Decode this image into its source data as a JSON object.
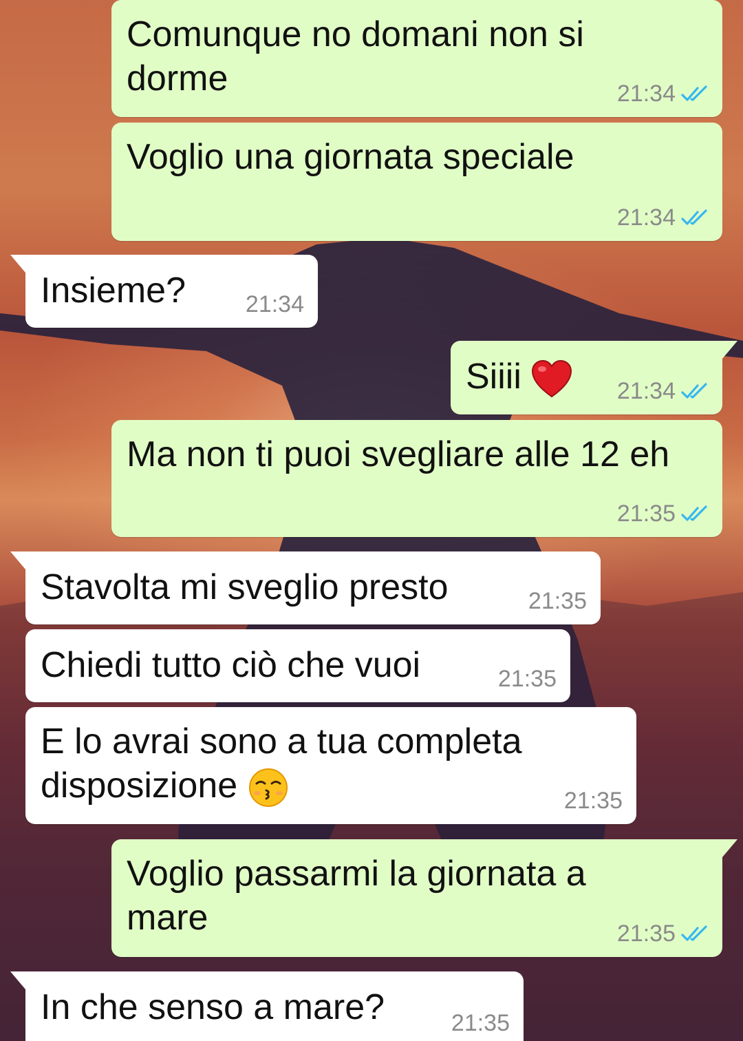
{
  "theme": {
    "outgoing_bubble": "#e1fdc6",
    "incoming_bubble": "#ffffff",
    "timestamp_color": "#8a8a8a",
    "read_ticks_color": "#34b7f1"
  },
  "messages": [
    {
      "direction": "outgoing",
      "lines": [
        "Comunque no domani non si",
        "dorme"
      ],
      "time": "21:34",
      "status": "read-double-check-icon"
    },
    {
      "direction": "outgoing",
      "lines": [
        "Voglio una giornata speciale"
      ],
      "time": "21:34",
      "status": "read-double-check-icon"
    },
    {
      "direction": "incoming",
      "lines": [
        "Insieme?"
      ],
      "time": "21:34"
    },
    {
      "direction": "outgoing",
      "lines": [
        "Siiii"
      ],
      "emoji": "red-heart-icon",
      "time": "21:34",
      "status": "read-double-check-icon"
    },
    {
      "direction": "outgoing",
      "lines": [
        "Ma non ti puoi svegliare alle 12 eh"
      ],
      "time": "21:35",
      "status": "read-double-check-icon"
    },
    {
      "direction": "incoming",
      "lines": [
        "Stavolta mi sveglio presto"
      ],
      "time": "21:35"
    },
    {
      "direction": "incoming",
      "lines": [
        "Chiedi tutto ciò che vuoi"
      ],
      "time": "21:35"
    },
    {
      "direction": "incoming",
      "lines": [
        "E lo avrai sono a tua completa",
        "disposizione"
      ],
      "emoji": "kissing-face-icon",
      "time": "21:35"
    },
    {
      "direction": "outgoing",
      "lines": [
        "Voglio passarmi la giornata a",
        "mare"
      ],
      "time": "21:35",
      "status": "read-double-check-icon"
    },
    {
      "direction": "incoming",
      "lines": [
        "In che senso a mare?"
      ],
      "time": "21:35"
    }
  ]
}
